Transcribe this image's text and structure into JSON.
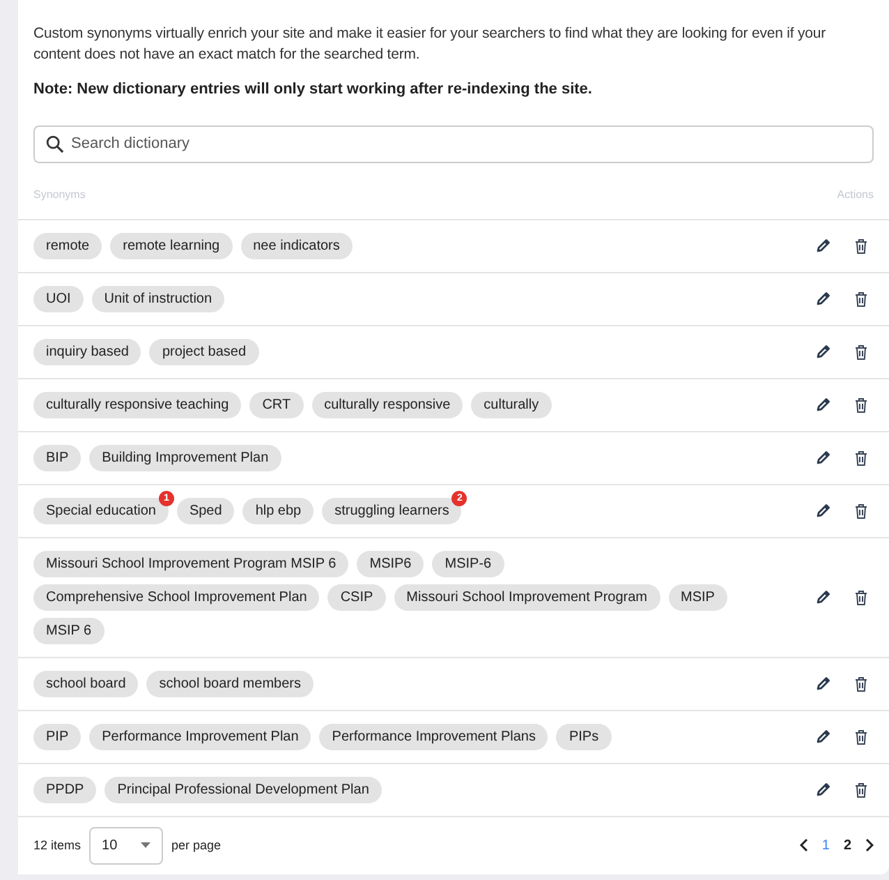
{
  "description": "Custom synonyms virtually enrich your site and make it easier for your searchers to find what they are looking for even if your content does not have an exact match for the searched term.",
  "note": "Note: New dictionary entries will only start working after re-indexing the site.",
  "search": {
    "placeholder": "Search dictionary"
  },
  "table": {
    "columns": [
      "Synonyms",
      "Actions"
    ],
    "rows": [
      {
        "synonyms": [
          {
            "text": "remote"
          },
          {
            "text": "remote learning"
          },
          {
            "text": "nee indicators"
          }
        ]
      },
      {
        "synonyms": [
          {
            "text": "UOI"
          },
          {
            "text": "Unit of instruction"
          }
        ]
      },
      {
        "synonyms": [
          {
            "text": "inquiry based"
          },
          {
            "text": "project based"
          }
        ]
      },
      {
        "synonyms": [
          {
            "text": "culturally responsive teaching"
          },
          {
            "text": "CRT"
          },
          {
            "text": "culturally responsive"
          },
          {
            "text": "culturally"
          }
        ]
      },
      {
        "synonyms": [
          {
            "text": "BIP"
          },
          {
            "text": "Building Improvement Plan"
          }
        ]
      },
      {
        "synonyms": [
          {
            "text": "Special education",
            "badge": "1"
          },
          {
            "text": "Sped"
          },
          {
            "text": "hlp ebp"
          },
          {
            "text": "struggling learners",
            "badge": "2"
          }
        ]
      },
      {
        "synonyms": [
          {
            "text": "Missouri School Improvement Program MSIP 6"
          },
          {
            "text": "MSIP6"
          },
          {
            "text": "MSIP-6"
          },
          {
            "text": "Comprehensive School Improvement Plan"
          },
          {
            "text": "CSIP"
          },
          {
            "text": "Missouri School Improvement Program"
          },
          {
            "text": "MSIP"
          },
          {
            "text": "MSIP 6"
          }
        ]
      },
      {
        "synonyms": [
          {
            "text": "school board"
          },
          {
            "text": "school board members"
          }
        ]
      },
      {
        "synonyms": [
          {
            "text": "PIP"
          },
          {
            "text": "Performance Improvement Plan"
          },
          {
            "text": "Performance Improvement Plans"
          },
          {
            "text": "PIPs"
          }
        ]
      },
      {
        "synonyms": [
          {
            "text": "PPDP"
          },
          {
            "text": "Principal Professional Development Plan"
          }
        ]
      }
    ]
  },
  "footer": {
    "count": "12 items",
    "per_page_value": "10",
    "per_page_label": "per page",
    "pages": [
      {
        "label": "1",
        "selected": true
      },
      {
        "label": "2",
        "selected": false
      }
    ]
  }
}
